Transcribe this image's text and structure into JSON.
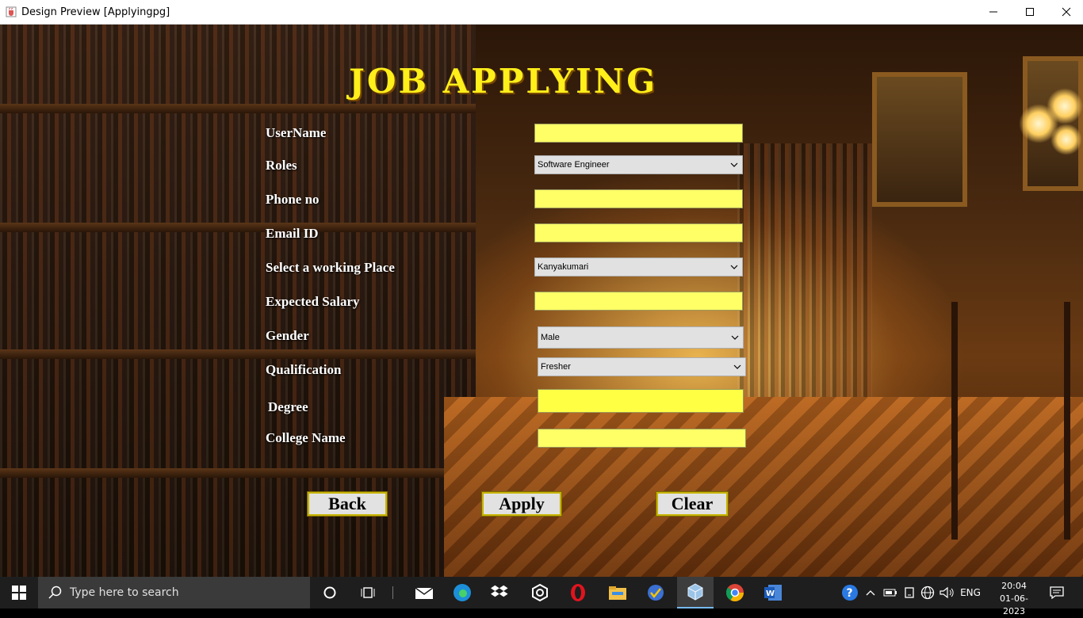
{
  "window": {
    "title": "Design Preview [Applyingpg]"
  },
  "form": {
    "heading": "JOB APPLYING",
    "labels": {
      "username": "UserName",
      "roles": "Roles",
      "phone": "Phone no",
      "email": "Email ID",
      "place": "Select a working Place",
      "salary": "Expected Salary",
      "gender": "Gender",
      "qualification": "Qualification",
      "degree": "Degree",
      "college": "College Name"
    },
    "values": {
      "username": "",
      "roles": "Software Engineer",
      "phone": "",
      "email": "",
      "place": "Kanyakumari",
      "salary": "",
      "gender": "Male",
      "qualification": "Fresher",
      "degree": "",
      "college": ""
    },
    "buttons": {
      "back": "Back",
      "apply": "Apply",
      "clear": "Clear"
    }
  },
  "colors": {
    "heading": "#ffef1a",
    "input_fill": "#ffff66",
    "label": "#ffffff",
    "taskbar": "#1e1e1e"
  },
  "taskbar": {
    "search_placeholder": "Type here to search",
    "apps": [
      "mail-icon",
      "edge-icon",
      "dropbox-icon",
      "lens-icon",
      "opera-icon",
      "file-explorer-icon",
      "vpn-icon",
      "java-app-icon",
      "chrome-icon",
      "word-icon"
    ],
    "language": "ENG",
    "time": "20:04",
    "date": "01-06-2023"
  }
}
